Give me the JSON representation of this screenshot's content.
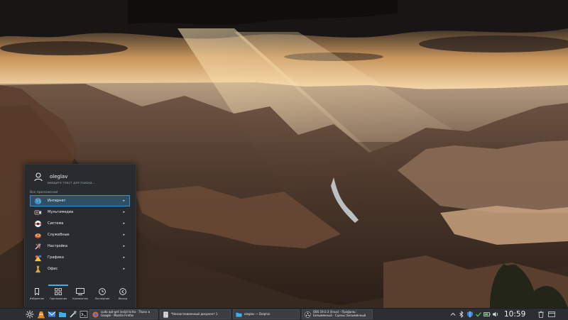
{
  "launcher": {
    "username": "oleglav",
    "search_placeholder": "Введите текст для поиска...",
    "section_title": "Все приложения",
    "categories": [
      {
        "label": "Интернет",
        "icon": "globe-icon",
        "active": true
      },
      {
        "label": "Мультимедиа",
        "icon": "multimedia-icon",
        "active": false
      },
      {
        "label": "Система",
        "icon": "system-icon",
        "active": false
      },
      {
        "label": "Служебные",
        "icon": "utilities-icon",
        "active": false
      },
      {
        "label": "Настройка",
        "icon": "settings-icon",
        "active": false
      },
      {
        "label": "Графика",
        "icon": "graphics-icon",
        "active": false
      },
      {
        "label": "Офис",
        "icon": "office-icon",
        "active": false
      }
    ],
    "tabs": [
      {
        "label": "Избранное",
        "icon": "bookmark-icon"
      },
      {
        "label": "Приложения",
        "icon": "grid-icon",
        "active": true
      },
      {
        "label": "Компьютер",
        "icon": "monitor-icon"
      },
      {
        "label": "Последние",
        "icon": "clock-icon"
      },
      {
        "label": "Выход",
        "icon": "back-arrow-icon"
      }
    ],
    "accent_color": "#3daee9"
  },
  "taskbar": {
    "tasks": [
      {
        "label": "sudo apt-get install krita - Thanx в Google - Mozilla Firefox",
        "icon": "firefox-icon"
      },
      {
        "label": "*Неозаглавленный документ 1",
        "icon": "text-editor-icon"
      },
      {
        "label": "oleglav — Dolphin",
        "icon": "dolphin-icon"
      },
      {
        "label": "OBS 19.0.3 (linux) - Профиль: Безымянный - Сцены: Безымянный",
        "icon": "obs-icon"
      }
    ],
    "clock": "10:59"
  }
}
